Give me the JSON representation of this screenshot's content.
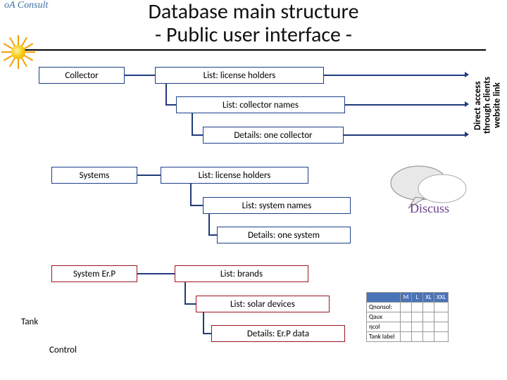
{
  "logo_text": "oA Consult",
  "title_line1": "Database main structure",
  "title_line2": "- Public user interface -",
  "side_label": "Direct access through clients website link",
  "sections": {
    "collector": {
      "label": "Collector",
      "l1": "List: license holders",
      "l2": "List: collector names",
      "l3": "Details: one collector"
    },
    "systems": {
      "label": "Systems",
      "l1": "List: license holders",
      "l2": "List: system names",
      "l3": "Details: one system"
    },
    "erp": {
      "label": "System Er.P",
      "l1": "List: brands",
      "l2": "List: solar devices",
      "l3": "Details: Er.P data"
    }
  },
  "bottom": {
    "tank": "Tank",
    "control": "Control"
  },
  "discuss_label": "Discuss",
  "table": {
    "headers": [
      "M",
      "L",
      "XL",
      "XXL"
    ],
    "rows": [
      "Qnonsol:",
      "Qaux",
      "ηcol",
      "Tank label"
    ]
  }
}
